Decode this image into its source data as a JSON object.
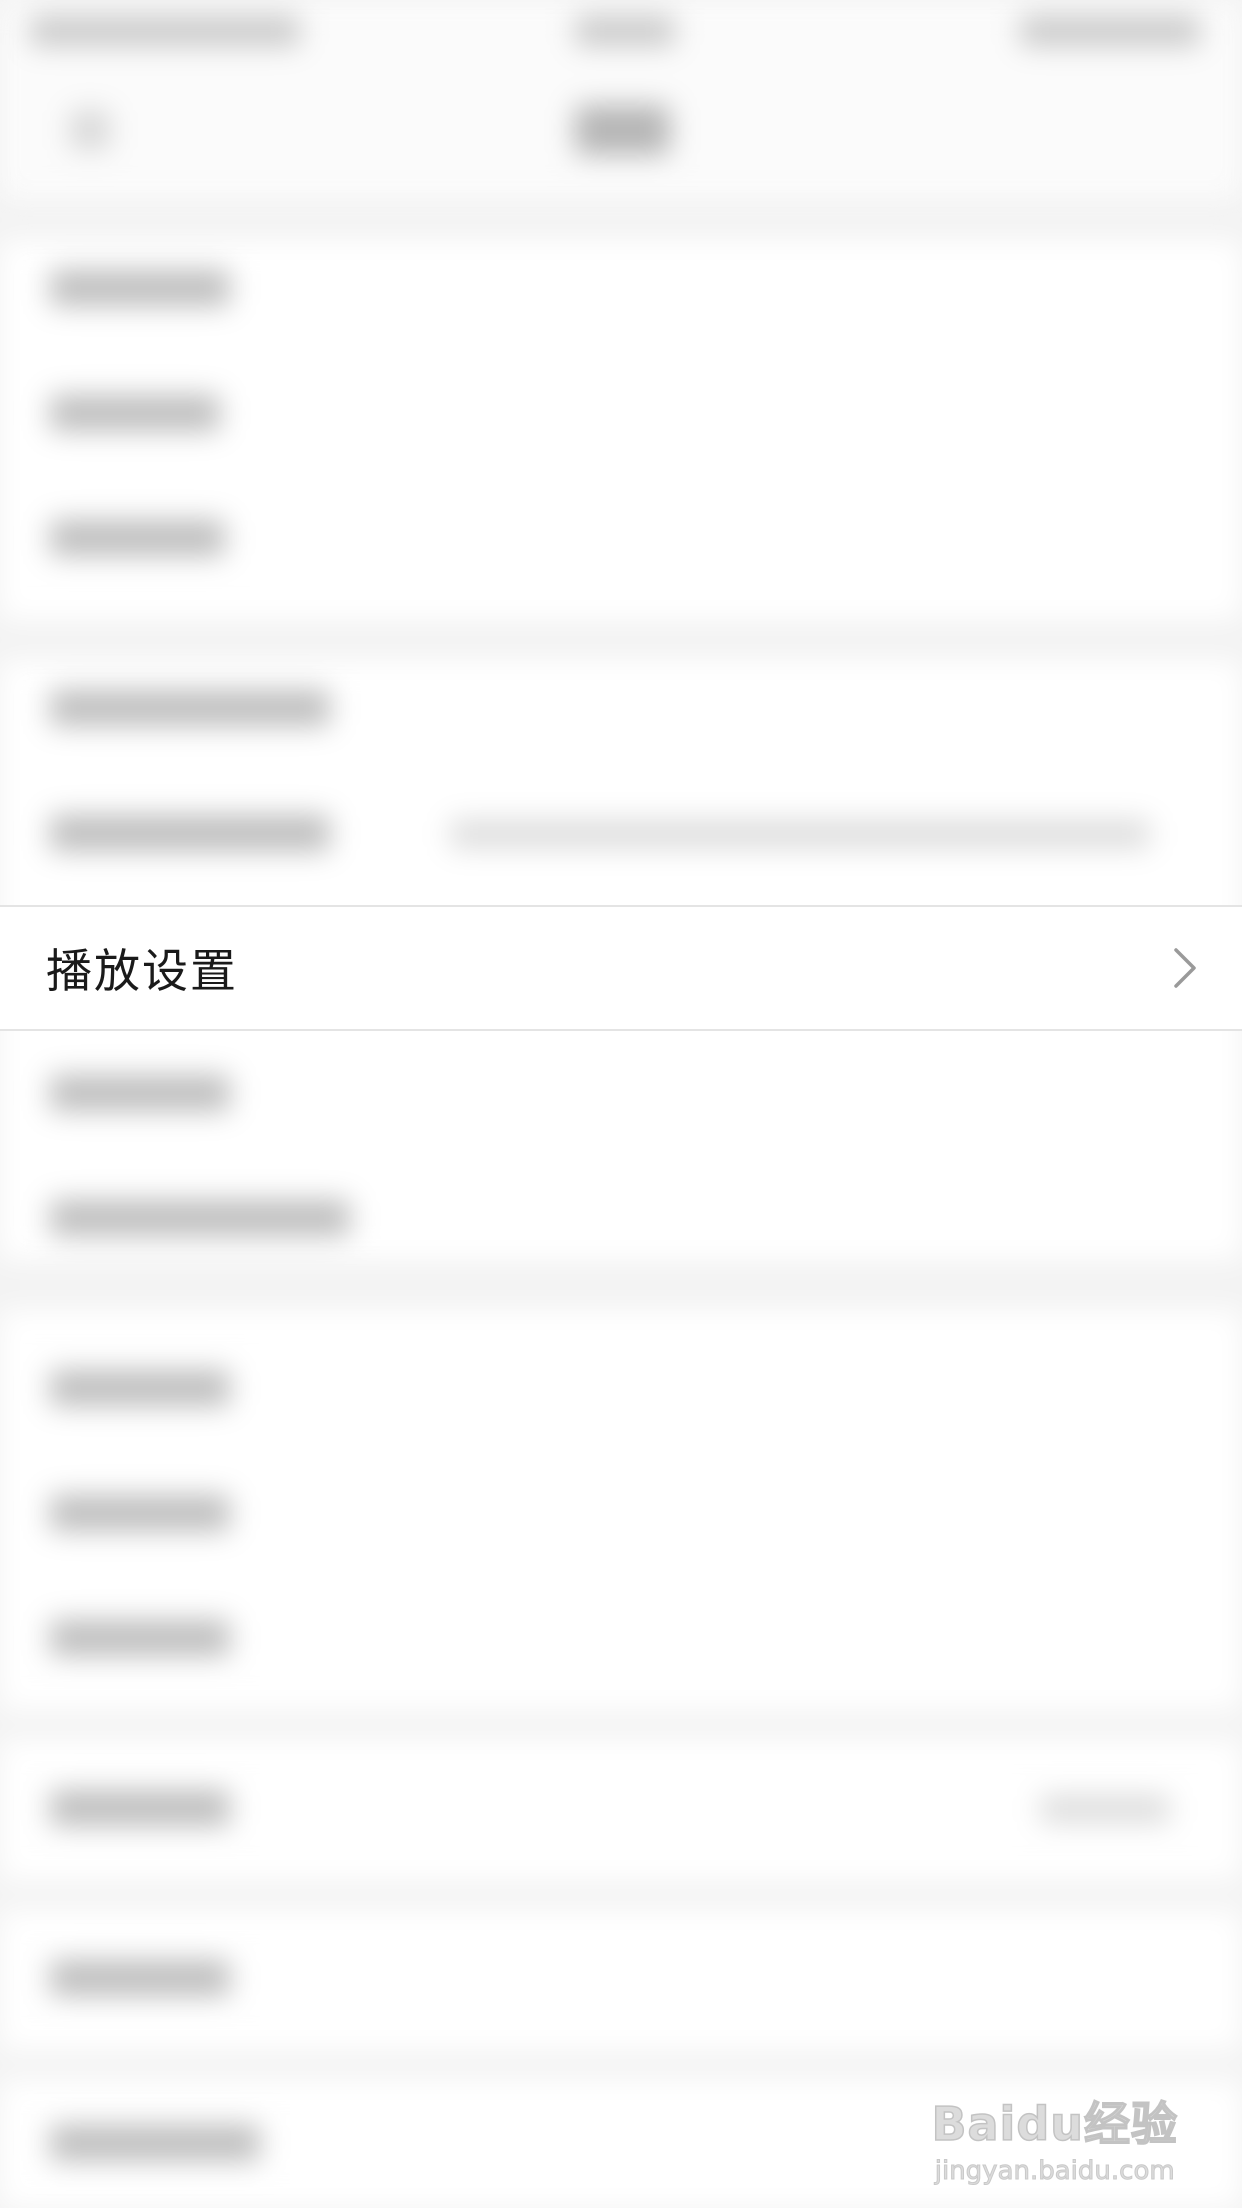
{
  "focused_row": {
    "label": "播放设置",
    "chevron_icon": "chevron-right-icon"
  },
  "watermark": {
    "logo_text": "Baidu经验",
    "url_text": "jingyan.baidu.com"
  },
  "colors": {
    "page_background": "#f3f3f3",
    "row_background": "#ffffff",
    "text_primary": "#1a1a1a",
    "chevron": "#9a9a9a",
    "divider": "#e4e4e4"
  }
}
